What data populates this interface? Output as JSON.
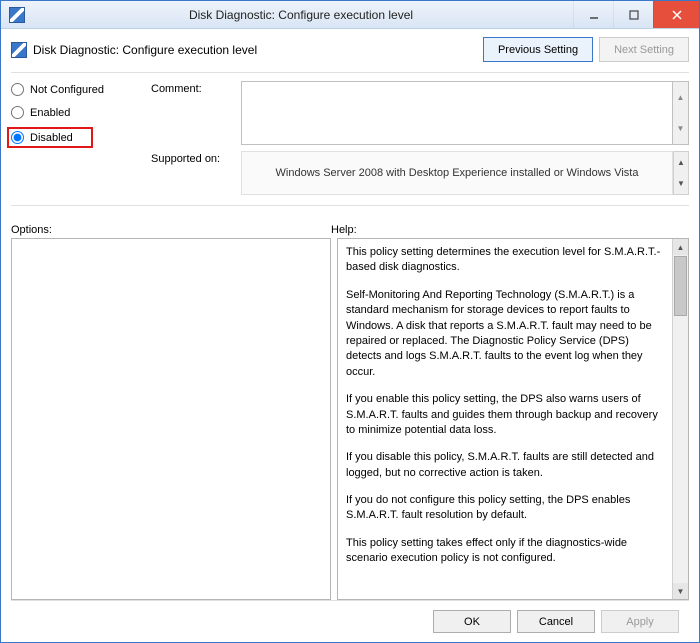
{
  "window": {
    "title": "Disk Diagnostic: Configure execution level"
  },
  "header": {
    "page_title": "Disk Diagnostic: Configure execution level",
    "prev_setting": "Previous Setting",
    "next_setting": "Next Setting"
  },
  "radios": {
    "not_configured": "Not Configured",
    "enabled": "Enabled",
    "disabled": "Disabled",
    "selected": "disabled"
  },
  "fields": {
    "comment_label": "Comment:",
    "comment_value": "",
    "supported_label": "Supported on:",
    "supported_value": "Windows Server 2008 with Desktop Experience installed or Windows Vista"
  },
  "labels": {
    "options": "Options:",
    "help": "Help:"
  },
  "help_paragraphs": [
    "This policy setting determines the execution level for S.M.A.R.T.-based disk diagnostics.",
    "Self-Monitoring And Reporting Technology (S.M.A.R.T.) is a standard mechanism for storage devices to report faults to Windows. A disk that reports a S.M.A.R.T. fault may need to be repaired or replaced. The Diagnostic Policy Service (DPS) detects and logs S.M.A.R.T. faults to the event log when they occur.",
    "If you enable this policy setting, the DPS also warns users of S.M.A.R.T. faults and guides them through backup and recovery to minimize potential data loss.",
    "If you disable this policy, S.M.A.R.T. faults are still detected and logged, but no corrective action is taken.",
    "If you do not configure this policy setting, the DPS enables S.M.A.R.T. fault resolution by default.",
    "This policy setting takes effect only if the diagnostics-wide scenario execution policy is not configured."
  ],
  "footer": {
    "ok": "OK",
    "cancel": "Cancel",
    "apply": "Apply"
  }
}
